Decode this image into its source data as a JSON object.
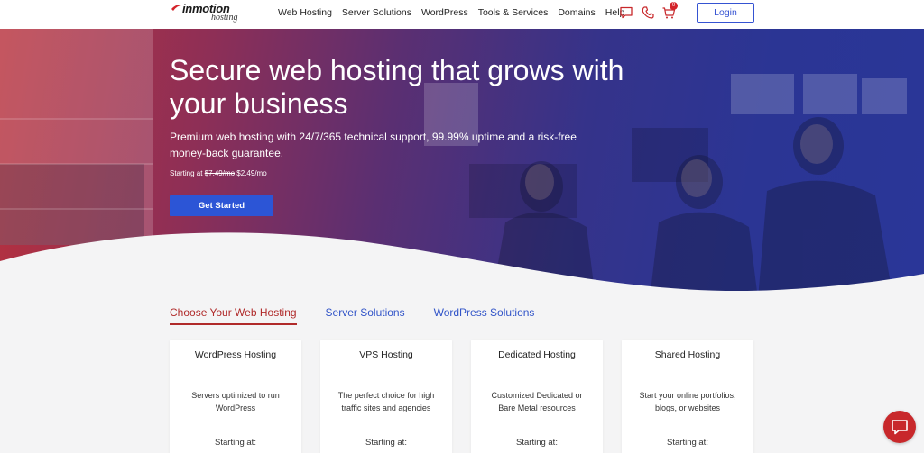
{
  "brand": {
    "name": "inmotion",
    "sub": "hosting"
  },
  "nav": {
    "items": [
      {
        "label": "Web Hosting"
      },
      {
        "label": "Server Solutions"
      },
      {
        "label": "WordPress"
      },
      {
        "label": "Tools & Services"
      },
      {
        "label": "Domains"
      },
      {
        "label": "Help"
      }
    ],
    "cart_count": "0",
    "login_label": "Login",
    "icons": [
      "chat-icon",
      "phone-icon",
      "cart-icon"
    ]
  },
  "hero": {
    "title": "Secure web hosting that grows with your business",
    "subtitle": "Premium web hosting with 24/7/365 technical support, 99.99% uptime and a risk-free money-back guarantee.",
    "price_prefix": "Starting at",
    "price_old": "$7.49/mo",
    "price_new": "$2.49/mo",
    "cta_label": "Get Started"
  },
  "tabs": [
    {
      "label": "Choose Your Web Hosting",
      "active": true
    },
    {
      "label": "Server Solutions",
      "active": false
    },
    {
      "label": "WordPress Solutions",
      "active": false
    }
  ],
  "cards": [
    {
      "title": "WordPress Hosting",
      "desc": "Servers optimized to run WordPress",
      "starting": "Starting at:"
    },
    {
      "title": "VPS Hosting",
      "desc": "The perfect choice for high traffic sites and agencies",
      "starting": "Starting at:"
    },
    {
      "title": "Dedicated Hosting",
      "desc": "Customized Dedicated or Bare Metal resources",
      "starting": "Starting at:"
    },
    {
      "title": "Shared Hosting",
      "desc": "Start your online portfolios, blogs, or websites",
      "starting": "Starting at:"
    }
  ],
  "colors": {
    "accent_blue": "#2c55d6",
    "accent_red": "#b02a2a",
    "link_blue": "#3154c8",
    "chat_red": "#c8282b"
  }
}
